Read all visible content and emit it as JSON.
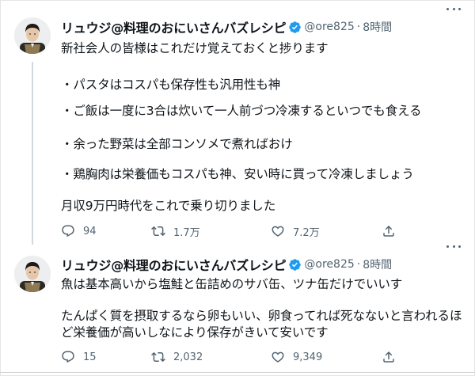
{
  "tweets": [
    {
      "author": {
        "display_name": "リュウジ@料理のおにいさんバズレシピ",
        "handle": "@ore825",
        "separator": "·",
        "time": "8時間"
      },
      "lines": [
        "新社会人の皆様はこれだけ覚えておくと捗ります",
        "・パスタはコスパも保存性も汎用性も神",
        "・ご飯は一度に3合は炊いて一人前づつ冷凍するといつでも食える",
        "・余った野菜は全部コンソメで煮ればおけ",
        "・鶏胸肉は栄養価もコスパも神、安い時に買って冷凍しましょう",
        "月収9万円時代をこれで乗り切りました"
      ],
      "stats": {
        "replies": "94",
        "retweets": "1.7万",
        "likes": "7.2万"
      }
    },
    {
      "author": {
        "display_name": "リュウジ@料理のおにいさんバズレシピ",
        "handle": "@ore825",
        "separator": "·",
        "time": "8時間"
      },
      "lines": [
        "魚は基本高いから塩鮭と缶詰めのサバ缶、ツナ缶だけでいいす",
        "たんぱく質を摂取するなら卵もいい、卵食ってれば死なないと言われるほ",
        "ど栄養価が高いしなにより保存がきいて安いです"
      ],
      "stats": {
        "replies": "15",
        "retweets": "2,032",
        "likes": "9,349"
      }
    }
  ],
  "icons": {
    "verified": "verified-badge-icon",
    "more": "more-icon",
    "reply": "reply-icon",
    "retweet": "retweet-icon",
    "like": "like-icon",
    "share": "share-icon"
  },
  "colors": {
    "text": "#0f1419",
    "muted": "#536471",
    "verified": "#1d9bf0",
    "thread_line": "#cfd9de"
  }
}
